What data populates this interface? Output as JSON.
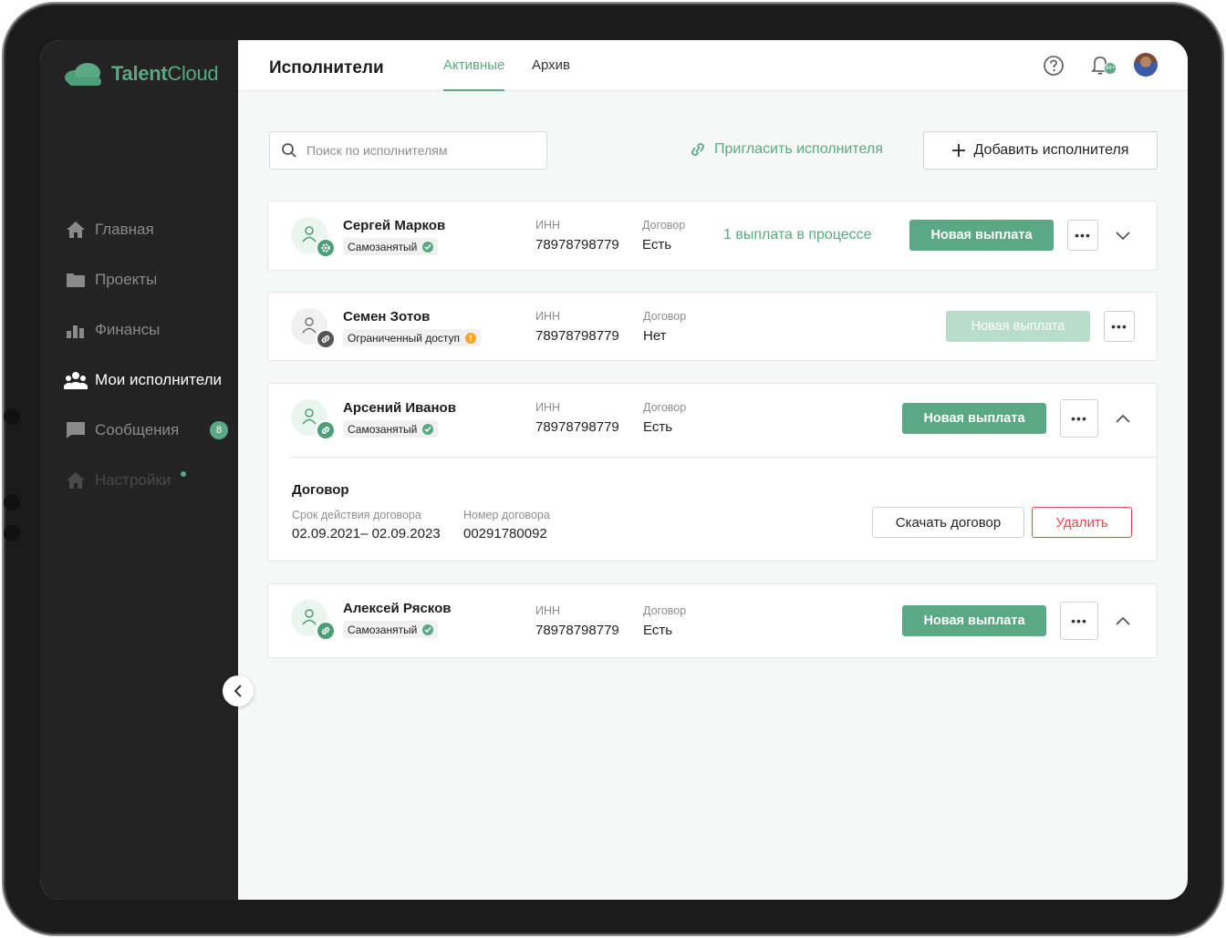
{
  "app": {
    "brand": "TalentCloud",
    "brand_bold": "Talent",
    "brand_light": "Cloud",
    "accent": "#5aa884"
  },
  "sidebar": {
    "items": [
      {
        "label": "Главная",
        "icon": "home-icon"
      },
      {
        "label": "Проекты",
        "icon": "folder-icon"
      },
      {
        "label": "Финансы",
        "icon": "chart-icon"
      },
      {
        "label": "Мои исполнители",
        "icon": "people-icon",
        "active": true
      },
      {
        "label": "Сообщения",
        "icon": "chat-icon",
        "badge": "8"
      },
      {
        "label": "Настройки",
        "icon": "home-icon",
        "dot": true
      }
    ]
  },
  "header": {
    "title": "Исполнители",
    "tabs": [
      {
        "label": "Активные",
        "active": true
      },
      {
        "label": "Архив"
      }
    ],
    "bell_badge": "99+"
  },
  "toolbar": {
    "search_placeholder": "Поиск по исполнителям",
    "invite_label": "Пригласить исполнителя",
    "add_label": "Добавить исполнителя"
  },
  "labels": {
    "inn": "ИНН",
    "contract": "Договор",
    "new_payment": "Новая выплата"
  },
  "performers": [
    {
      "name": "Сергей Марков",
      "status": "Самозанятый",
      "inn": "78978798779",
      "contract": "Есть",
      "progress": "1 выплата в процессе"
    },
    {
      "name": "Семен Зотов",
      "status": "Ограниченный доступ",
      "inn": "78978798779",
      "contract": "Нет"
    },
    {
      "name": "Арсений Иванов",
      "status": "Самозанятый",
      "inn": "78978798779",
      "contract": "Есть"
    },
    {
      "name": "Алексей Рясков",
      "status": "Самозанятый",
      "inn": "78978798779",
      "contract": "Есть"
    }
  ],
  "contract_details": {
    "title": "Договор",
    "term_label": "Срок действия договора",
    "term_value": "02.09.2021– 02.09.2023",
    "number_label": "Номер договора",
    "number_value": "00291780092",
    "download_label": "Скачать договор",
    "delete_label": "Удалить"
  }
}
